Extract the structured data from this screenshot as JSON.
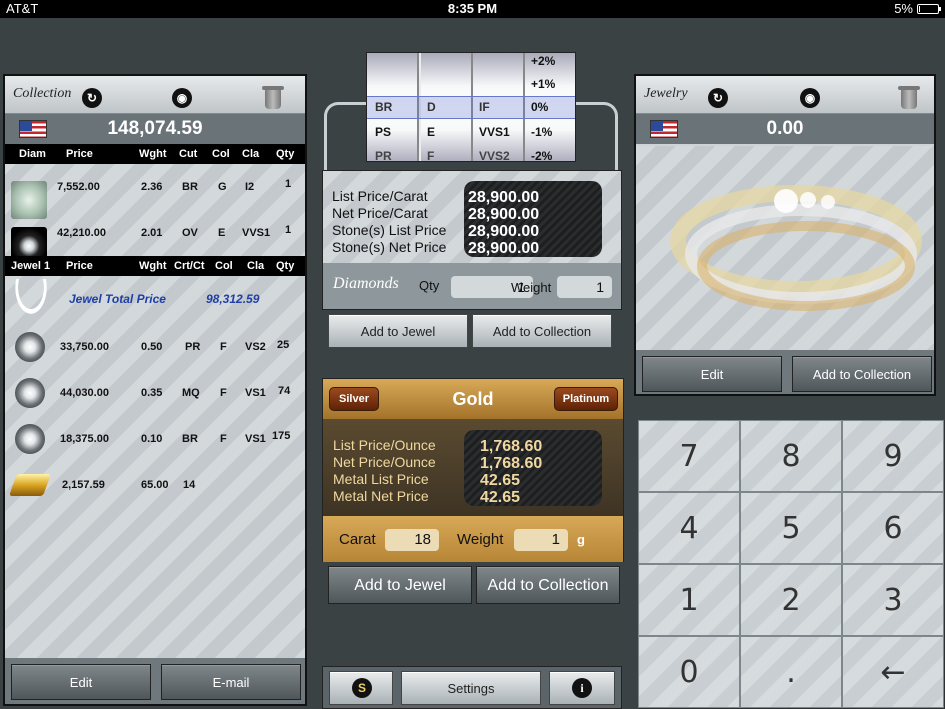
{
  "status": {
    "carrier": "AT&T",
    "time": "8:35 PM",
    "battery": "5%",
    "battery_level": 0.05
  },
  "collection": {
    "title": "Collection",
    "total": "148,074.59",
    "diam_headers": [
      "Diam",
      "Price",
      "Wght",
      "Cut",
      "Col",
      "Cla",
      "Qty"
    ],
    "diamonds": [
      {
        "price": "7,552.00",
        "weight": "2.36",
        "cut": "BR",
        "color": "G",
        "clarity": "I2",
        "qty": "1"
      },
      {
        "price": "42,210.00",
        "weight": "2.01",
        "cut": "OV",
        "color": "E",
        "clarity": "VVS1",
        "qty": "1"
      }
    ],
    "jewel_headers": [
      "Jewel 1",
      "Price",
      "Wght",
      "Crt/Ct",
      "Col",
      "Cla",
      "Qty"
    ],
    "jewel_total_label": "Jewel Total Price",
    "jewel_total": "98,312.59",
    "jewel_items": [
      {
        "price": "33,750.00",
        "weight": "0.50",
        "cut": "PR",
        "color": "F",
        "clarity": "VS2",
        "qty": "25"
      },
      {
        "price": "44,030.00",
        "weight": "0.35",
        "cut": "MQ",
        "color": "F",
        "clarity": "VS1",
        "qty": "74"
      },
      {
        "price": "18,375.00",
        "weight": "0.10",
        "cut": "BR",
        "color": "F",
        "clarity": "VS1",
        "qty": "175"
      }
    ],
    "gold_item": {
      "price": "2,157.59",
      "weight": "65.00",
      "carat": "14"
    },
    "edit_label": "Edit",
    "email_label": "E-mail"
  },
  "tumbler": {
    "cut": [
      "",
      "",
      "BR",
      "PS",
      "PR"
    ],
    "color": [
      "",
      "",
      "D",
      "E",
      "F"
    ],
    "clarity": [
      "",
      "",
      "IF",
      "VVS1",
      "VVS2"
    ],
    "adjust": [
      "+2%",
      "+1%",
      "0%",
      "-1%",
      "-2%"
    ]
  },
  "diamond_prices": {
    "labels": [
      "List Price/Carat",
      "Net Price/Carat",
      "Stone(s) List Price",
      "Stone(s) Net Price"
    ],
    "values": [
      "28,900.00",
      "28,900.00",
      "28,900.00",
      "28,900.00"
    ],
    "section_label": "Diamonds",
    "qty_label": "Qty",
    "qty": "1",
    "weight_label": "Weight",
    "weight": "1",
    "add_jewel": "Add to Jewel",
    "add_collection": "Add to Collection"
  },
  "metal": {
    "silver": "Silver",
    "selected": "Gold",
    "platinum": "Platinum",
    "labels": [
      "List Price/Ounce",
      "Net Price/Ounce",
      "Metal List Price",
      "Metal Net Price"
    ],
    "values": [
      "1,768.60",
      "1,768.60",
      "42.65",
      "42.65"
    ],
    "carat_label": "Carat",
    "carat": "18",
    "weight_label": "Weight",
    "weight": "1",
    "unit": "g",
    "add_jewel": "Add to Jewel",
    "add_collection": "Add to Collection"
  },
  "bottom_bar": {
    "s_label": "S",
    "settings": "Settings",
    "info": "i"
  },
  "jewelry": {
    "title": "Jewelry",
    "total": "0.00",
    "edit_label": "Edit",
    "add_collection": "Add to Collection"
  },
  "keypad": {
    "keys": [
      "7",
      "8",
      "9",
      "4",
      "5",
      "6",
      "1",
      "2",
      "3",
      "0",
      ".",
      "←"
    ]
  },
  "colors": {
    "background": "#3b4244",
    "gold": "#e7c987",
    "accent_blue": "#1f3fa6"
  }
}
